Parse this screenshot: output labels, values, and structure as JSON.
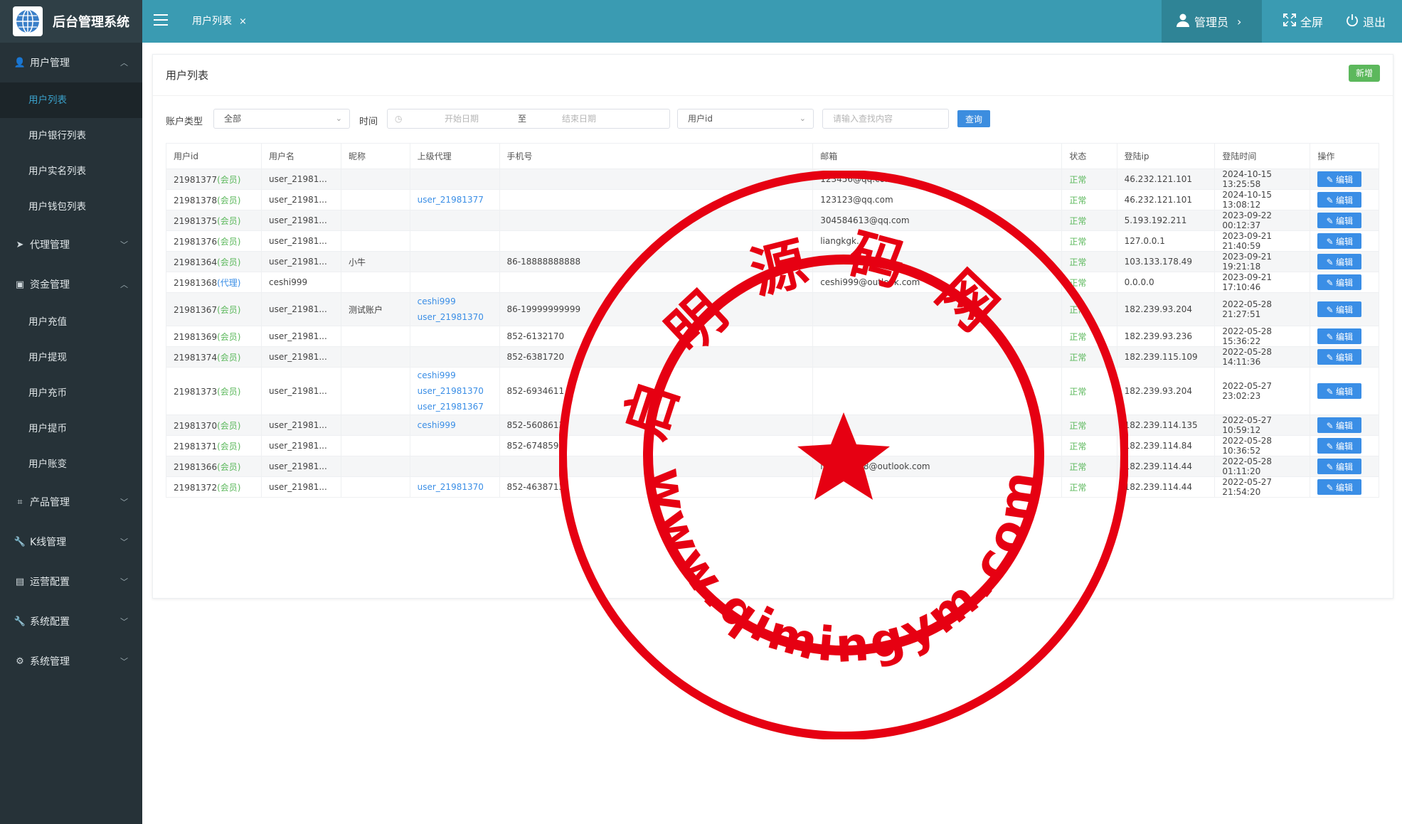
{
  "app": {
    "title": "后台管理系统"
  },
  "sidebar": {
    "groups": [
      {
        "label": "用户管理",
        "icon": "users-icon",
        "expanded": true,
        "items": [
          {
            "label": "用户列表",
            "active": true
          },
          {
            "label": "用户银行列表"
          },
          {
            "label": "用户实名列表"
          },
          {
            "label": "用户钱包列表"
          }
        ]
      },
      {
        "label": "代理管理",
        "icon": "paper-plane-icon",
        "expanded": false,
        "items": []
      },
      {
        "label": "资金管理",
        "icon": "briefcase-icon",
        "expanded": true,
        "items": [
          {
            "label": "用户充值"
          },
          {
            "label": "用户提现"
          },
          {
            "label": "用户充币"
          },
          {
            "label": "用户提币"
          },
          {
            "label": "用户账变"
          }
        ]
      },
      {
        "label": "产品管理",
        "icon": "sitemap-icon",
        "expanded": false,
        "items": []
      },
      {
        "label": "K线管理",
        "icon": "wrench-icon",
        "expanded": false,
        "items": []
      },
      {
        "label": "运营配置",
        "icon": "files-icon",
        "expanded": false,
        "items": []
      },
      {
        "label": "系统配置",
        "icon": "wrench-icon",
        "expanded": false,
        "items": []
      },
      {
        "label": "系统管理",
        "icon": "user-gear-icon",
        "expanded": false,
        "items": []
      }
    ]
  },
  "header": {
    "tab_label": "用户列表",
    "tab_close": "×",
    "admin_label": "管理员",
    "fullscreen_label": "全屏",
    "logout_label": "退出",
    "color": "#3a9bb2"
  },
  "page": {
    "title": "用户列表",
    "new_button": "新增",
    "filters": {
      "account_type_label": "账户类型",
      "account_type_value": "全部",
      "time_label": "时间",
      "start_placeholder": "开始日期",
      "range_sep": "至",
      "end_placeholder": "结束日期",
      "field_select": "用户id",
      "search_placeholder": "请输入查找内容",
      "query_button": "查询"
    },
    "table": {
      "columns": [
        "用户id",
        "用户名",
        "昵称",
        "上级代理",
        "手机号",
        "邮箱",
        "状态",
        "登陆ip",
        "登陆时间",
        "操作"
      ],
      "edit_label": "编辑",
      "rows": [
        {
          "id": "21981377",
          "role": "(会员)",
          "username": "user_21981...",
          "nickname": "",
          "agents": [],
          "phone": "",
          "email": "123456@qq.com",
          "status": "正常",
          "ip": "46.232.121.101",
          "time": "2024-10-15 13:25:58"
        },
        {
          "id": "21981378",
          "role": "(会员)",
          "username": "user_21981...",
          "nickname": "",
          "agents": [
            "user_21981377"
          ],
          "phone": "",
          "email": "123123@qq.com",
          "status": "正常",
          "ip": "46.232.121.101",
          "time": "2024-10-15 13:08:12"
        },
        {
          "id": "21981375",
          "role": "(会员)",
          "username": "user_21981...",
          "nickname": "",
          "agents": [],
          "phone": "",
          "email": "304584613@qq.com",
          "status": "正常",
          "ip": "5.193.192.211",
          "time": "2023-09-22 00:12:37"
        },
        {
          "id": "21981376",
          "role": "(会员)",
          "username": "user_21981...",
          "nickname": "",
          "agents": [],
          "phone": "",
          "email": "liangkgk...",
          "status": "正常",
          "ip": "127.0.0.1",
          "time": "2023-09-21 21:40:59"
        },
        {
          "id": "21981364",
          "role": "(会员)",
          "username": "user_21981...",
          "nickname": "小牛",
          "agents": [],
          "phone": "86-18888888888",
          "email": "",
          "status": "正常",
          "ip": "103.133.178.49",
          "time": "2023-09-21 19:21:18"
        },
        {
          "id": "21981368",
          "role": "(代理)",
          "username": "ceshi999",
          "nickname": "",
          "agents": [],
          "phone": "",
          "email": "ceshi999@outlook.com",
          "status": "正常",
          "ip": "0.0.0.0",
          "time": "2023-09-21 17:10:46"
        },
        {
          "id": "21981367",
          "role": "(会员)",
          "username": "user_21981...",
          "nickname": "测试账户",
          "agents": [
            "ceshi999",
            "user_21981370"
          ],
          "phone": "86-19999999999",
          "email": "",
          "status": "正常",
          "ip": "182.239.93.204",
          "time": "2022-05-28 21:27:51"
        },
        {
          "id": "21981369",
          "role": "(会员)",
          "username": "user_21981...",
          "nickname": "",
          "agents": [],
          "phone": "852-6132170",
          "email": "",
          "status": "正常",
          "ip": "182.239.93.236",
          "time": "2022-05-28 15:36:22"
        },
        {
          "id": "21981374",
          "role": "(会员)",
          "username": "user_21981...",
          "nickname": "",
          "agents": [],
          "phone": "852-6381720",
          "email": "",
          "status": "正常",
          "ip": "182.239.115.109",
          "time": "2022-05-28 14:11:36"
        },
        {
          "id": "21981373",
          "role": "(会员)",
          "username": "user_21981...",
          "nickname": "",
          "agents": [
            "ceshi999",
            "user_21981370",
            "user_21981367"
          ],
          "phone": "852-6934611",
          "email": "",
          "status": "正常",
          "ip": "182.239.93.204",
          "time": "2022-05-27 23:02:23"
        },
        {
          "id": "21981370",
          "role": "(会员)",
          "username": "user_21981...",
          "nickname": "",
          "agents": [
            "ceshi999"
          ],
          "phone": "852-5608613",
          "email": "",
          "status": "正常",
          "ip": "182.239.114.135",
          "time": "2022-05-27 10:59:12"
        },
        {
          "id": "21981371",
          "role": "(会员)",
          "username": "user_21981...",
          "nickname": "",
          "agents": [],
          "phone": "852-674859",
          "email": "",
          "status": "正常",
          "ip": "182.239.114.84",
          "time": "2022-05-28 10:36:52"
        },
        {
          "id": "21981366",
          "role": "(会员)",
          "username": "user_21981...",
          "nickname": "",
          "agents": [],
          "phone": "",
          "email": "linzichen98@outlook.com",
          "status": "正常",
          "ip": "182.239.114.44",
          "time": "2022-05-28 01:11:20"
        },
        {
          "id": "21981372",
          "role": "(会员)",
          "username": "user_21981...",
          "nickname": "",
          "agents": [
            "user_21981370"
          ],
          "phone": "852-4638713",
          "email": "",
          "status": "正常",
          "ip": "182.239.114.44",
          "time": "2022-05-27 21:54:20"
        }
      ]
    }
  },
  "watermark": {
    "top_text": "启明源码网",
    "bottom_text": "www.qimingym.com",
    "color": "#e60012"
  }
}
